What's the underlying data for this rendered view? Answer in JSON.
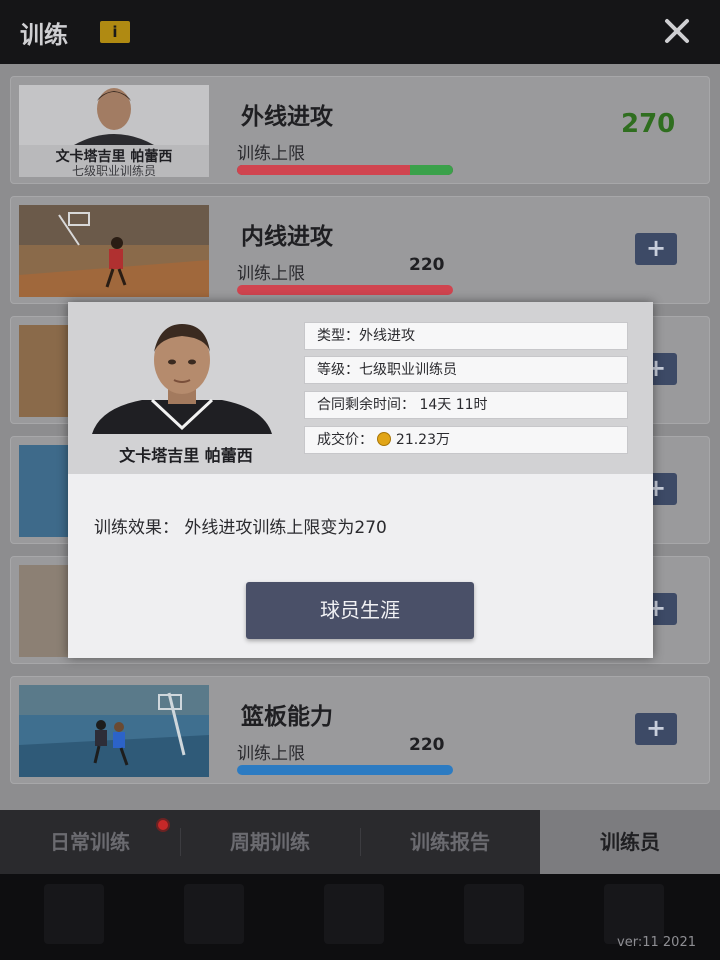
{
  "header": {
    "title": "训练",
    "info_icon": "i"
  },
  "rows": [
    {
      "name": "外线进攻",
      "label": "训练上限",
      "value": "270",
      "trainer_name": "文卡塔吉里 帕蕾西",
      "trainer_level": "七级职业训练员",
      "bar_fraction": 0.8,
      "bar_boost_fraction": 0.2
    },
    {
      "name": "内线进攻",
      "label": "训练上限",
      "value": "220",
      "bar_fraction": 1.0
    },
    {
      "name": "篮板能力",
      "label": "训练上限",
      "value": "220",
      "bar_fraction": 1.0
    }
  ],
  "tabs": [
    "日常训练",
    "周期训练",
    "训练报告",
    "训练员"
  ],
  "active_tab": "训练员",
  "version": "ver:11  2021",
  "modal": {
    "player_name": "文卡塔吉里 帕蕾西",
    "type_label": "类型：外线进攻",
    "level_label": "等级：七级职业训练员",
    "contract_label": "合同剩余时间：",
    "contract_value": "14天 11时",
    "price_label": "成交价：",
    "price_value": "21.23万",
    "effect_text": "训练效果：  外线进攻训练上限变为270",
    "career_button": "球员生涯"
  },
  "colors": {
    "bar_red": "#d0444f",
    "bar_green": "#3aa14a",
    "bar_blue": "#2c7bc2",
    "plus_button": "#3d4a66",
    "value_green": "#2f6e1f"
  },
  "icons": {
    "close": "close-icon",
    "info": "info-icon",
    "add": "plus-icon",
    "coin": "coin-icon"
  }
}
